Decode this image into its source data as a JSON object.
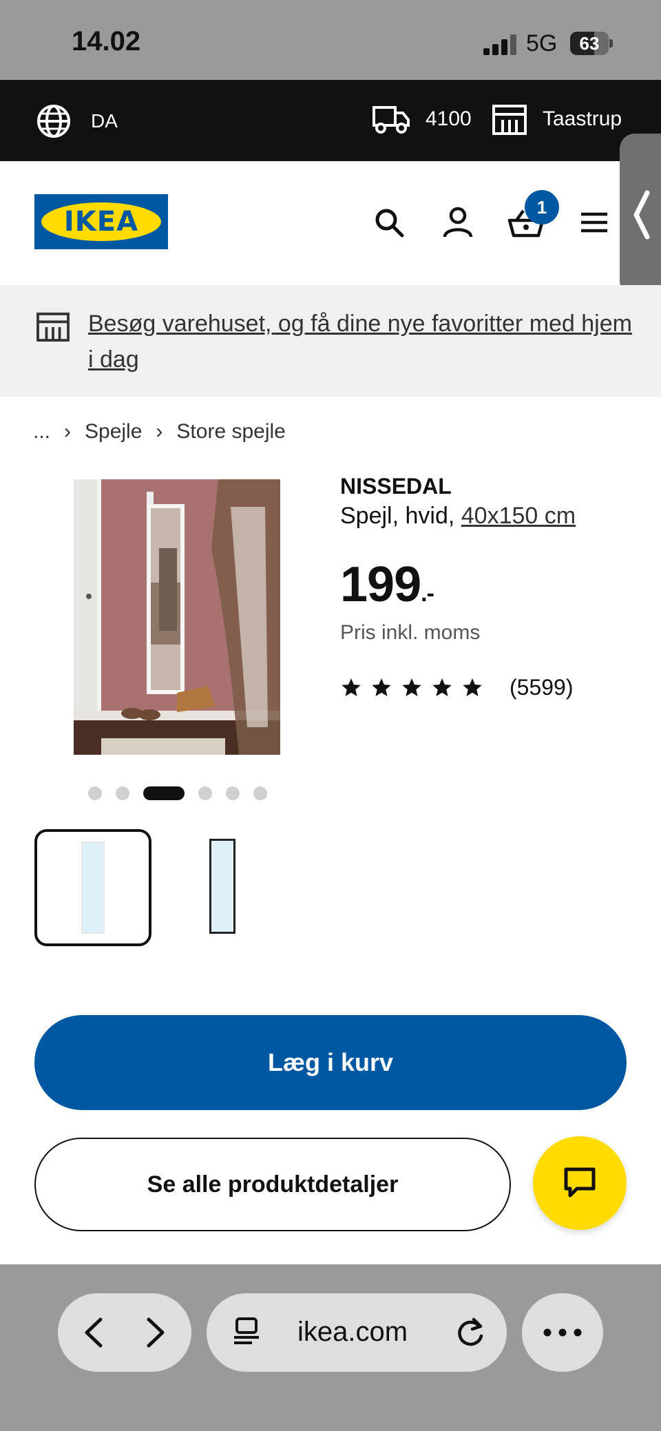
{
  "status_bar": {
    "time": "14.02",
    "network": "5G",
    "battery": "63",
    "battery_level": 0.63
  },
  "topbar": {
    "language": "DA",
    "postal_code": "4100",
    "store": "Taastrup"
  },
  "header": {
    "logo_text": "IKEA",
    "cart_count": "1",
    "icons": [
      "search-icon",
      "user-icon",
      "cart-icon",
      "menu-icon"
    ]
  },
  "banner": {
    "text": "Besøg varehuset, og få dine nye favoritter med hjem i dag"
  },
  "breadcrumb": {
    "ellipsis": "...",
    "items": [
      "Spejle",
      "Store spejle"
    ]
  },
  "product": {
    "name": "NISSEDAL",
    "description": "Spejl, hvid, ",
    "size": "40x150 cm",
    "price": "199",
    "price_suffix": ".-",
    "price_note": "Pris inkl. moms",
    "rating": 5,
    "review_count": "(5599)"
  },
  "carousel": {
    "total": 6,
    "active_index": 2
  },
  "buttons": {
    "add_to_cart": "Læg i kurv",
    "all_details": "Se alle produktdetaljer"
  },
  "browser": {
    "url": "ikea.com"
  },
  "colors": {
    "ikea_blue": "#0058a3",
    "ikea_yellow": "#ffdb00"
  }
}
